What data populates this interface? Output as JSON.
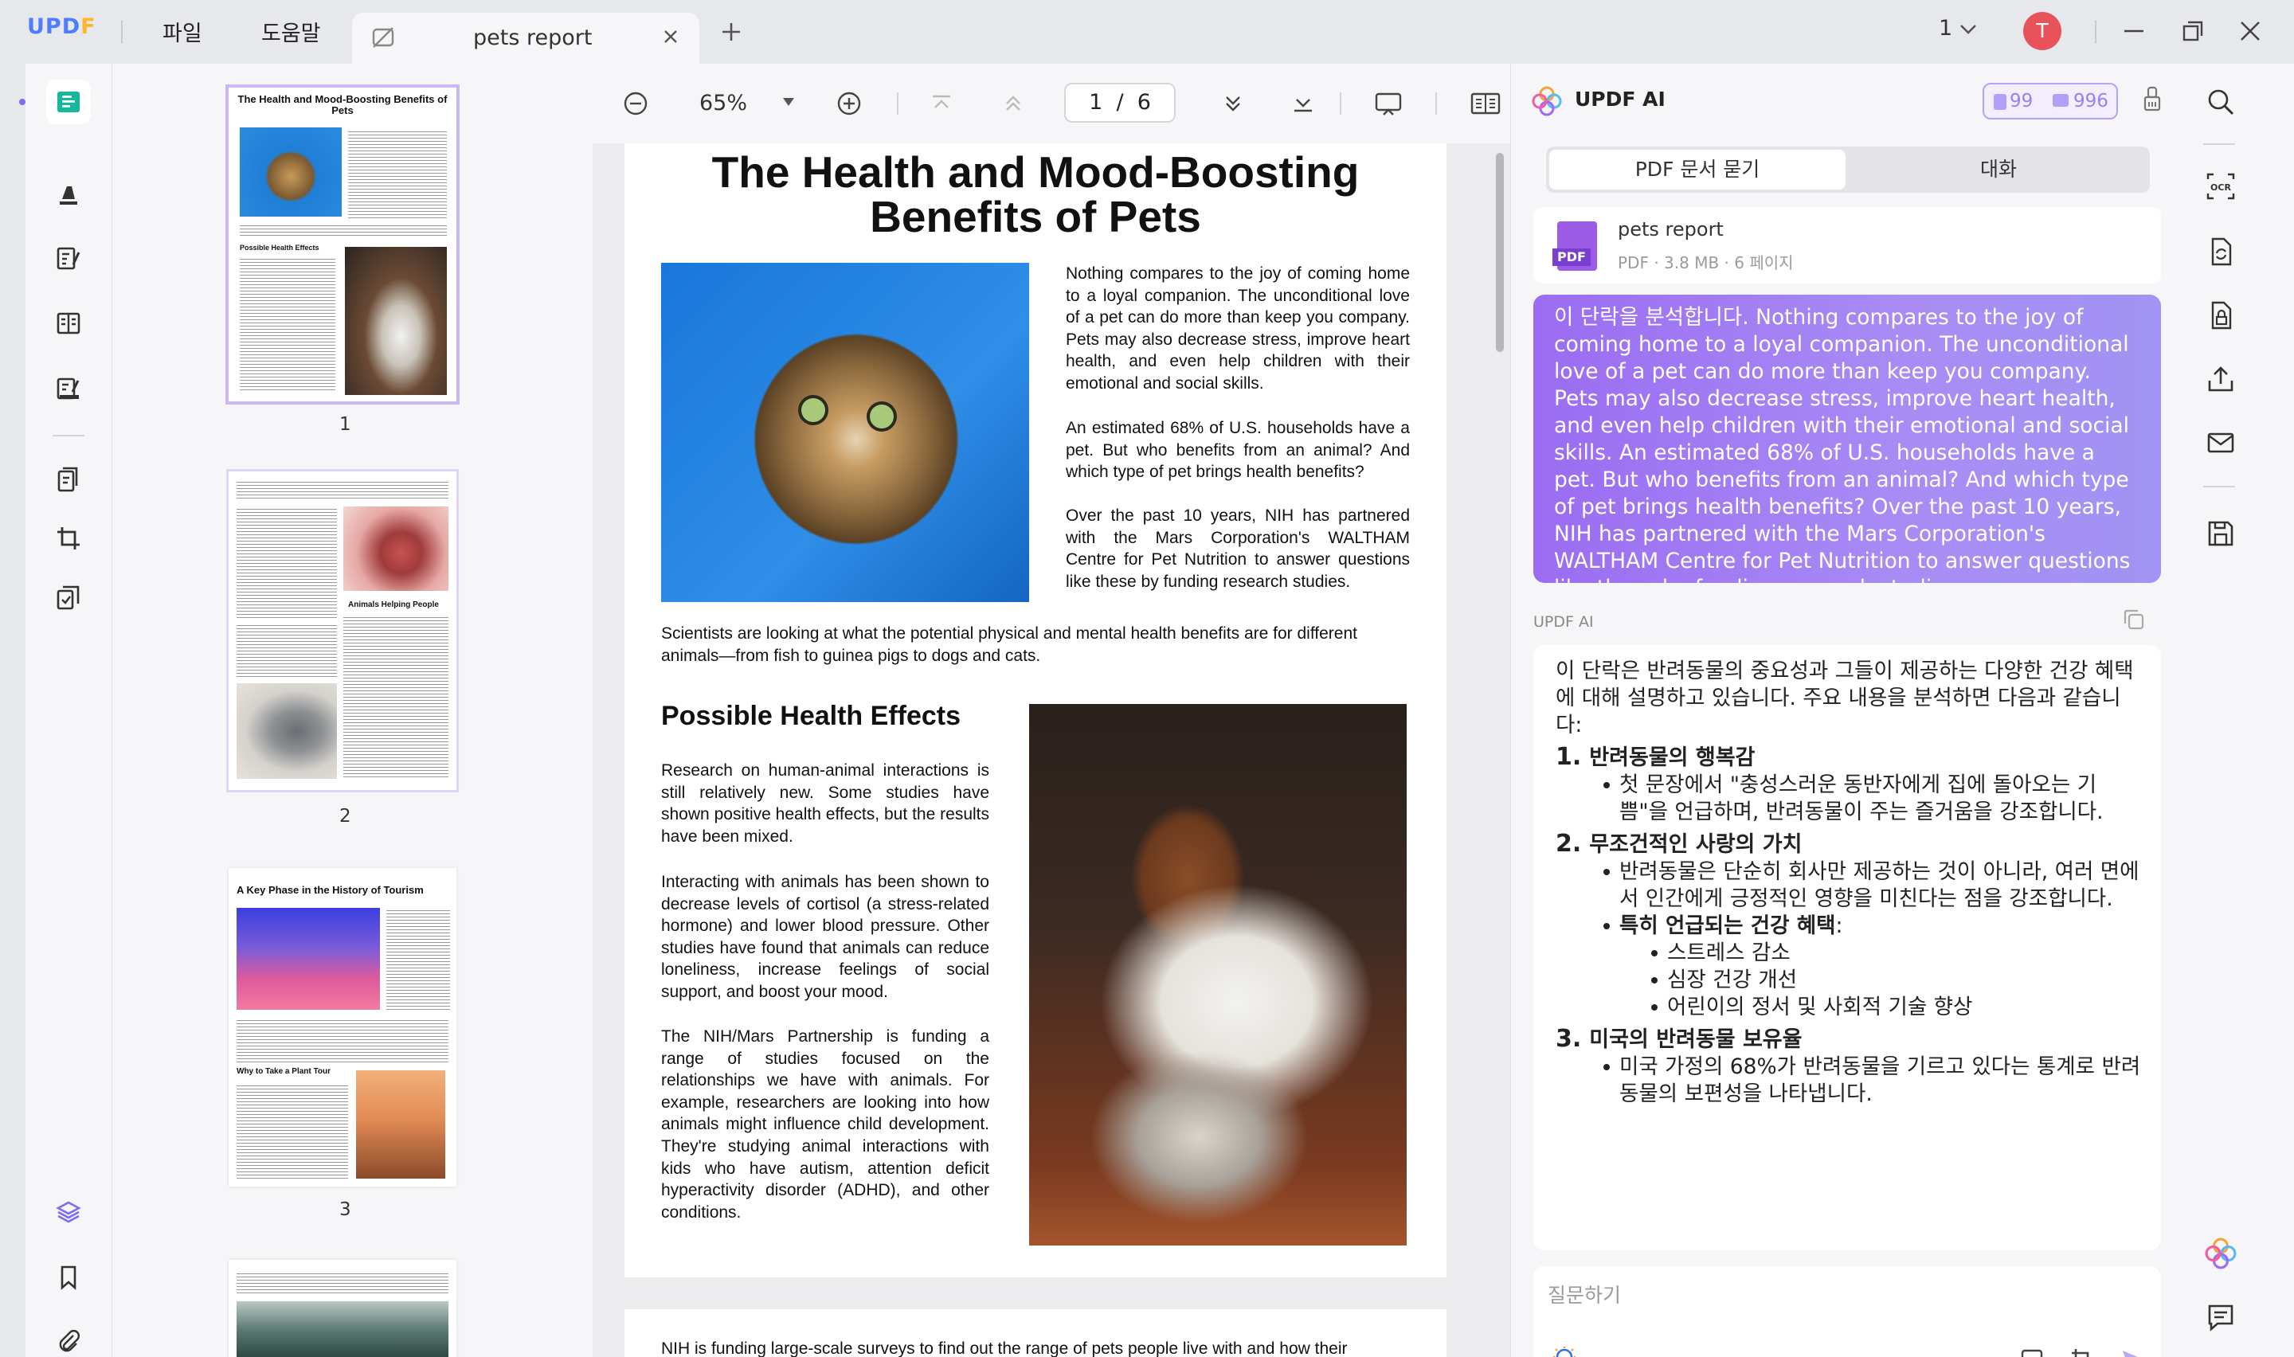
{
  "app": {
    "logo": "UPDF",
    "menu": [
      "파일",
      "도움말"
    ],
    "tab_title": "pets report",
    "page_indicator": "1",
    "avatar_initial": "T"
  },
  "toolbar": {
    "zoom": "65%",
    "page_current": "1",
    "page_sep": "/",
    "page_total": "6"
  },
  "thumbnails": [
    {
      "number": "1",
      "title": "The Health and Mood-Boosting Benefits of Pets"
    },
    {
      "number": "2",
      "heading": "Animals Helping People"
    },
    {
      "number": "3",
      "title": "A Key Phase in the History of Tourism",
      "heading": "Why to Take a Plant Tour"
    }
  ],
  "page1": {
    "title_line1": "The Health and Mood-Boosting",
    "title_line2": "Benefits of Pets",
    "para1": "Nothing compares to the joy of coming home to a loyal companion. The unconditional love of a pet can do more than keep you company. Pets may also decrease stress, improve heart health, and even help children with their emotional and social skills.",
    "para2": "An estimated 68% of U.S. households have a pet. But who benefits from an animal? And which type of pet brings health benefits?",
    "para3": "Over the past 10 years, NIH has partnered with the Mars Corporation's WALTHAM Centre for Pet Nutrition to answer questions like these by funding research studies.",
    "para4": "Scientists are looking at what the potential physical and mental health benefits are for different animals—from fish to guinea pigs to dogs and cats.",
    "heading": "Possible Health Effects",
    "para5": "Research on human-animal interactions is still relatively new. Some studies have shown positive health effects, but the results have been mixed.",
    "para6": "Interacting with animals has been shown to decrease levels of cortisol (a stress-related hormone) and lower blood pressure. Other studies have found that animals can reduce loneliness, increase feelings of social support, and boost your mood.",
    "para7": "The NIH/Mars Partnership is funding a range of studies focused on the relationships we have with animals. For example, researchers are looking into how animals might influence child development. They're studying animal interactions with kids who have autism, attention deficit hyperactivity disorder (ADHD), and other conditions."
  },
  "page2": {
    "para1": "NIH is funding large-scale surveys to find out the range of pets people live with and how their"
  },
  "ai": {
    "title": "UPDF AI",
    "credits1": "99",
    "credits2": "996",
    "tab_ask_pdf": "PDF 문서 묻기",
    "tab_chat": "대화",
    "file_name": "pets report",
    "file_meta": "PDF · 3.8 MB · 6 페이지",
    "file_badge": "PDF",
    "user_message": "이 단락을 분석합니다. Nothing compares to the joy of coming home to a loyal companion. The unconditional love of a pet can do more than keep you company. Pets may also decrease stress, improve heart health, and even help children with their emotional and social skills. An estimated 68% of U.S. households have a pet. But who benefits from an animal? And which type of pet brings health benefits? Over the past 10 years, NIH has partnered with the Mars Corporation's WALTHAM Centre for Pet Nutrition to answer questions like these by funding research studies.",
    "ai_label": "UPDF AI",
    "answer_intro": "이 단락은 반려동물의 중요성과 그들이 제공하는 다양한 건강 혜택에 대해 설명하고 있습니다. 주요 내용을 분석하면 다음과 같습니다:",
    "s1_num": "1.",
    "s1_title": "반려동물의 행복감",
    "s1_b1": "첫 문장에서 \"충성스러운 동반자에게 집에 돌아오는 기쁨\"을 언급하며, 반려동물이 주는 즐거움을 강조합니다.",
    "s2_num": "2.",
    "s2_title": "무조건적인 사랑의 가치",
    "s2_b1": "반려동물은 단순히 회사만 제공하는 것이 아니라, 여러 면에서 인간에게 긍정적인 영향을 미친다는 점을 강조합니다.",
    "s2_b2_bold": "특히 언급되는 건강 혜택",
    "s2_b2_rest": ":",
    "s2_sub": [
      "스트레스 감소",
      "심장 건강 개선",
      "어린이의 정서 및 사회적 기술 향상"
    ],
    "s3_num": "3.",
    "s3_title": "미국의 반려동물 보유율",
    "s3_b1": "미국 가정의 68%가 반려동물을 기르고 있다는 통계로 반려동물의 보편성을 나타냅니다.",
    "input_placeholder": "질문하기"
  },
  "colors": {
    "accent": "#8f6cf0",
    "brand_blue": "#4e7cff",
    "brand_yellow": "#ffb52e",
    "avatar": "#e8525a"
  }
}
